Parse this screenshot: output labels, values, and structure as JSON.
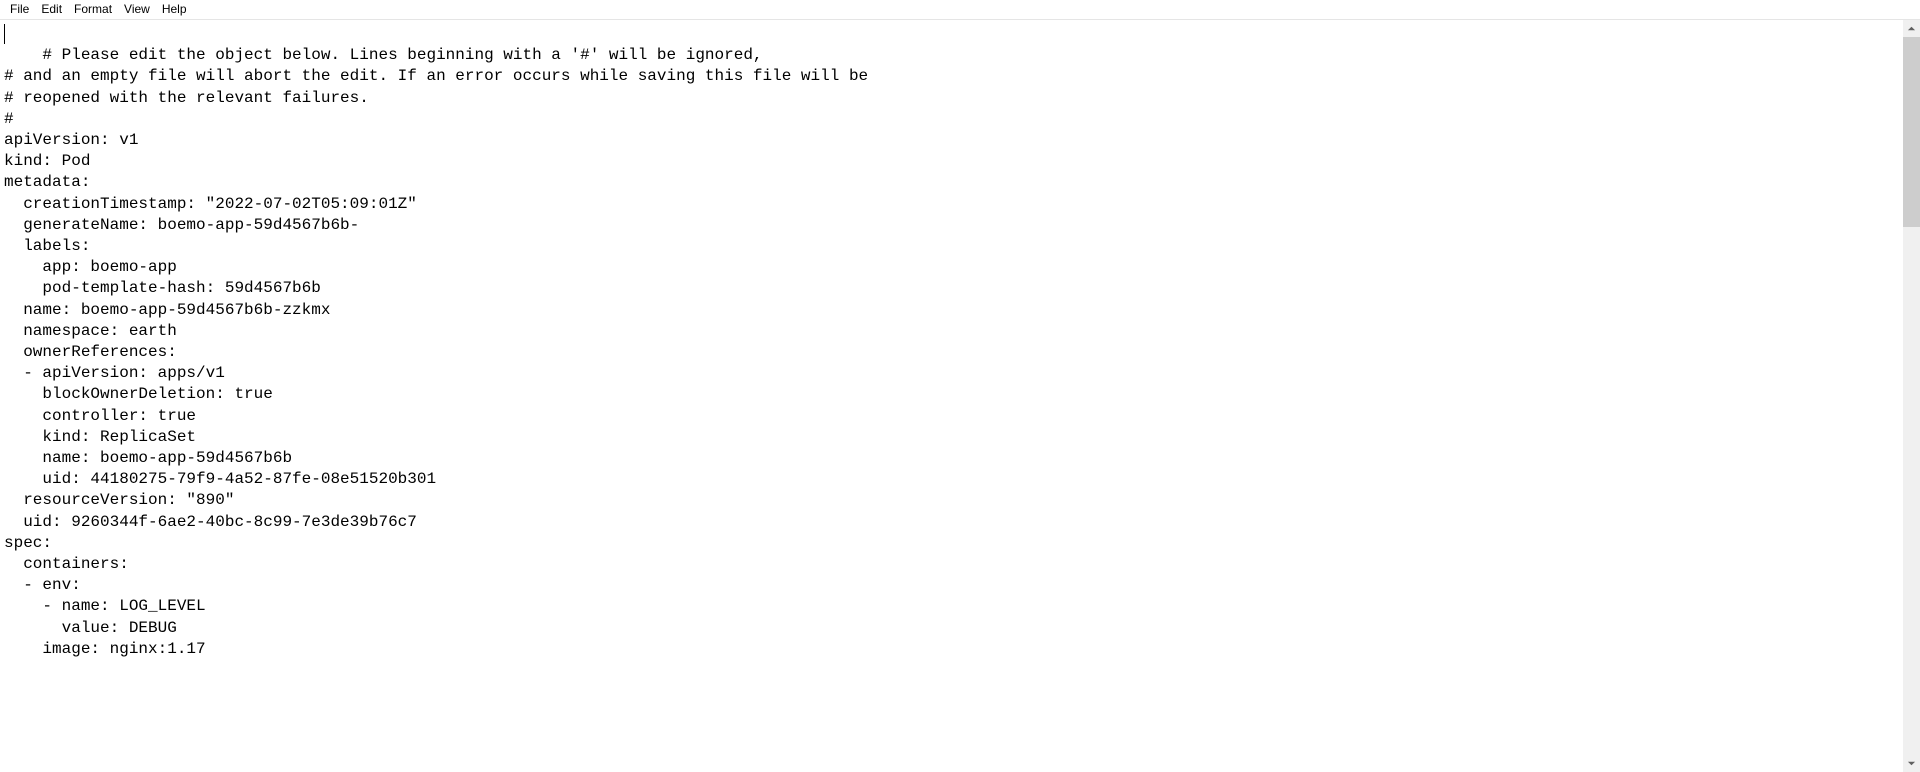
{
  "menu": {
    "file": "File",
    "edit": "Edit",
    "format": "Format",
    "view": "View",
    "help": "Help"
  },
  "content": "# Please edit the object below. Lines beginning with a '#' will be ignored,\n# and an empty file will abort the edit. If an error occurs while saving this file will be\n# reopened with the relevant failures.\n#\napiVersion: v1\nkind: Pod\nmetadata:\n  creationTimestamp: \"2022-07-02T05:09:01Z\"\n  generateName: boemo-app-59d4567b6b-\n  labels:\n    app: boemo-app\n    pod-template-hash: 59d4567b6b\n  name: boemo-app-59d4567b6b-zzkmx\n  namespace: earth\n  ownerReferences:\n  - apiVersion: apps/v1\n    blockOwnerDeletion: true\n    controller: true\n    kind: ReplicaSet\n    name: boemo-app-59d4567b6b\n    uid: 44180275-79f9-4a52-87fe-08e51520b301\n  resourceVersion: \"890\"\n  uid: 9260344f-6ae2-40bc-8c99-7e3de39b76c7\nspec:\n  containers:\n  - env:\n    - name: LOG_LEVEL\n      value: DEBUG\n    image: nginx:1.17"
}
